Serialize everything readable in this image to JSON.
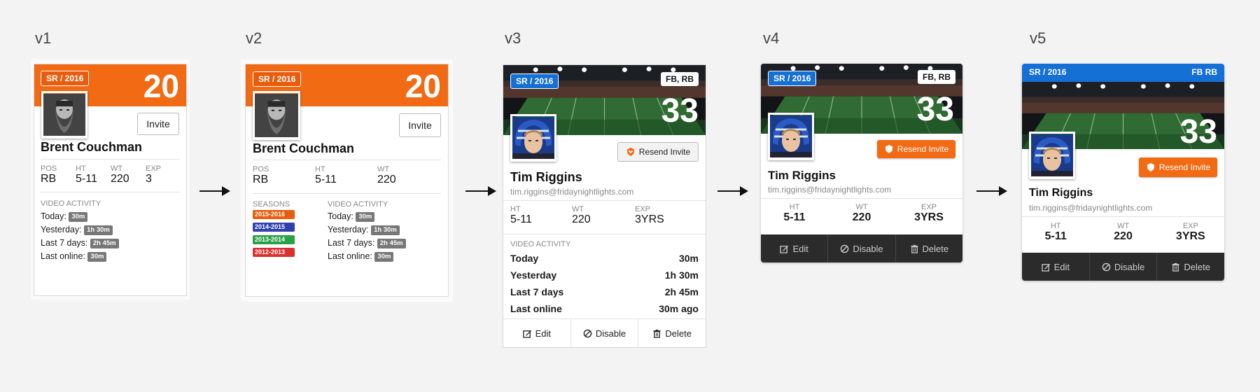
{
  "version_labels": [
    "v1",
    "v2",
    "v3",
    "v4",
    "v5"
  ],
  "colors": {
    "orange": "#f26a14",
    "blue": "#1570d6",
    "dark": "#2b2b2b",
    "season_2015": "#e85c0d",
    "season_2014": "#2f3fae",
    "season_2013": "#2aa147",
    "season_2012": "#d93030"
  },
  "v1": {
    "class_badge": "SR / 2016",
    "number": "20",
    "invite": "Invite",
    "name": "Brent Couchman",
    "stats": [
      {
        "label": "POS",
        "value": "RB"
      },
      {
        "label": "HT",
        "value": "5-11"
      },
      {
        "label": "WT",
        "value": "220"
      },
      {
        "label": "EXP",
        "value": "3"
      }
    ],
    "activity_title": "VIDEO ACTIVITY",
    "activity": [
      {
        "label": "Today:",
        "value": "30m"
      },
      {
        "label": "Yesterday:",
        "value": "1h 30m"
      },
      {
        "label": "Last 7 days:",
        "value": "2h 45m"
      },
      {
        "label": "Last online:",
        "value": "30m"
      }
    ]
  },
  "v2": {
    "class_badge": "SR / 2016",
    "number": "20",
    "invite": "Invite",
    "name": "Brent Couchman",
    "stats": [
      {
        "label": "POS",
        "value": "RB"
      },
      {
        "label": "HT",
        "value": "5-11"
      },
      {
        "label": "WT",
        "value": "220"
      }
    ],
    "seasons_title": "SEASONS",
    "seasons": [
      "2015-2016",
      "2014-2015",
      "2013-2014",
      "2012-2013"
    ],
    "activity_title": "VIDEO ACTIVITY",
    "activity": [
      {
        "label": "Today:",
        "value": "30m"
      },
      {
        "label": "Yesterday:",
        "value": "1h 30m"
      },
      {
        "label": "Last 7 days:",
        "value": "2h 45m"
      },
      {
        "label": "Last online:",
        "value": "30m"
      }
    ]
  },
  "v3": {
    "class_badge": "SR / 2016",
    "positions": "FB, RB",
    "number": "33",
    "resend": "Resend Invite",
    "name": "Tim Riggins",
    "email": "tim.riggins@fridaynightlights.com",
    "stats": [
      {
        "label": "HT",
        "value": "5-11"
      },
      {
        "label": "WT",
        "value": "220"
      },
      {
        "label": "EXP",
        "value": "3YRS"
      }
    ],
    "activity_title": "VIDEO ACTIVITY",
    "activity": [
      {
        "label": "Today",
        "value": "30m"
      },
      {
        "label": "Yesterday",
        "value": "1h 30m"
      },
      {
        "label": "Last 7 days",
        "value": "2h 45m"
      },
      {
        "label": "Last online",
        "value": "30m ago"
      }
    ],
    "actions": {
      "edit": "Edit",
      "disable": "Disable",
      "delete": "Delete"
    }
  },
  "v4": {
    "class_badge": "SR / 2016",
    "positions": "FB, RB",
    "number": "33",
    "resend": "Resend Invite",
    "name": "Tim Riggins",
    "email": "tim.riggins@fridaynightlights.com",
    "stats": [
      {
        "label": "HT",
        "value": "5-11"
      },
      {
        "label": "WT",
        "value": "220"
      },
      {
        "label": "EXP",
        "value": "3YRS"
      }
    ],
    "actions": {
      "edit": "Edit",
      "disable": "Disable",
      "delete": "Delete"
    }
  },
  "v5": {
    "class_badge": "SR / 2016",
    "positions": "FB RB",
    "number": "33",
    "resend": "Resend Invite",
    "name": "Tim Riggins",
    "email": "tim.riggins@fridaynightlights.com",
    "stats": [
      {
        "label": "HT",
        "value": "5-11"
      },
      {
        "label": "WT",
        "value": "220"
      },
      {
        "label": "EXP",
        "value": "3YRS"
      }
    ],
    "actions": {
      "edit": "Edit",
      "disable": "Disable",
      "delete": "Delete"
    }
  }
}
